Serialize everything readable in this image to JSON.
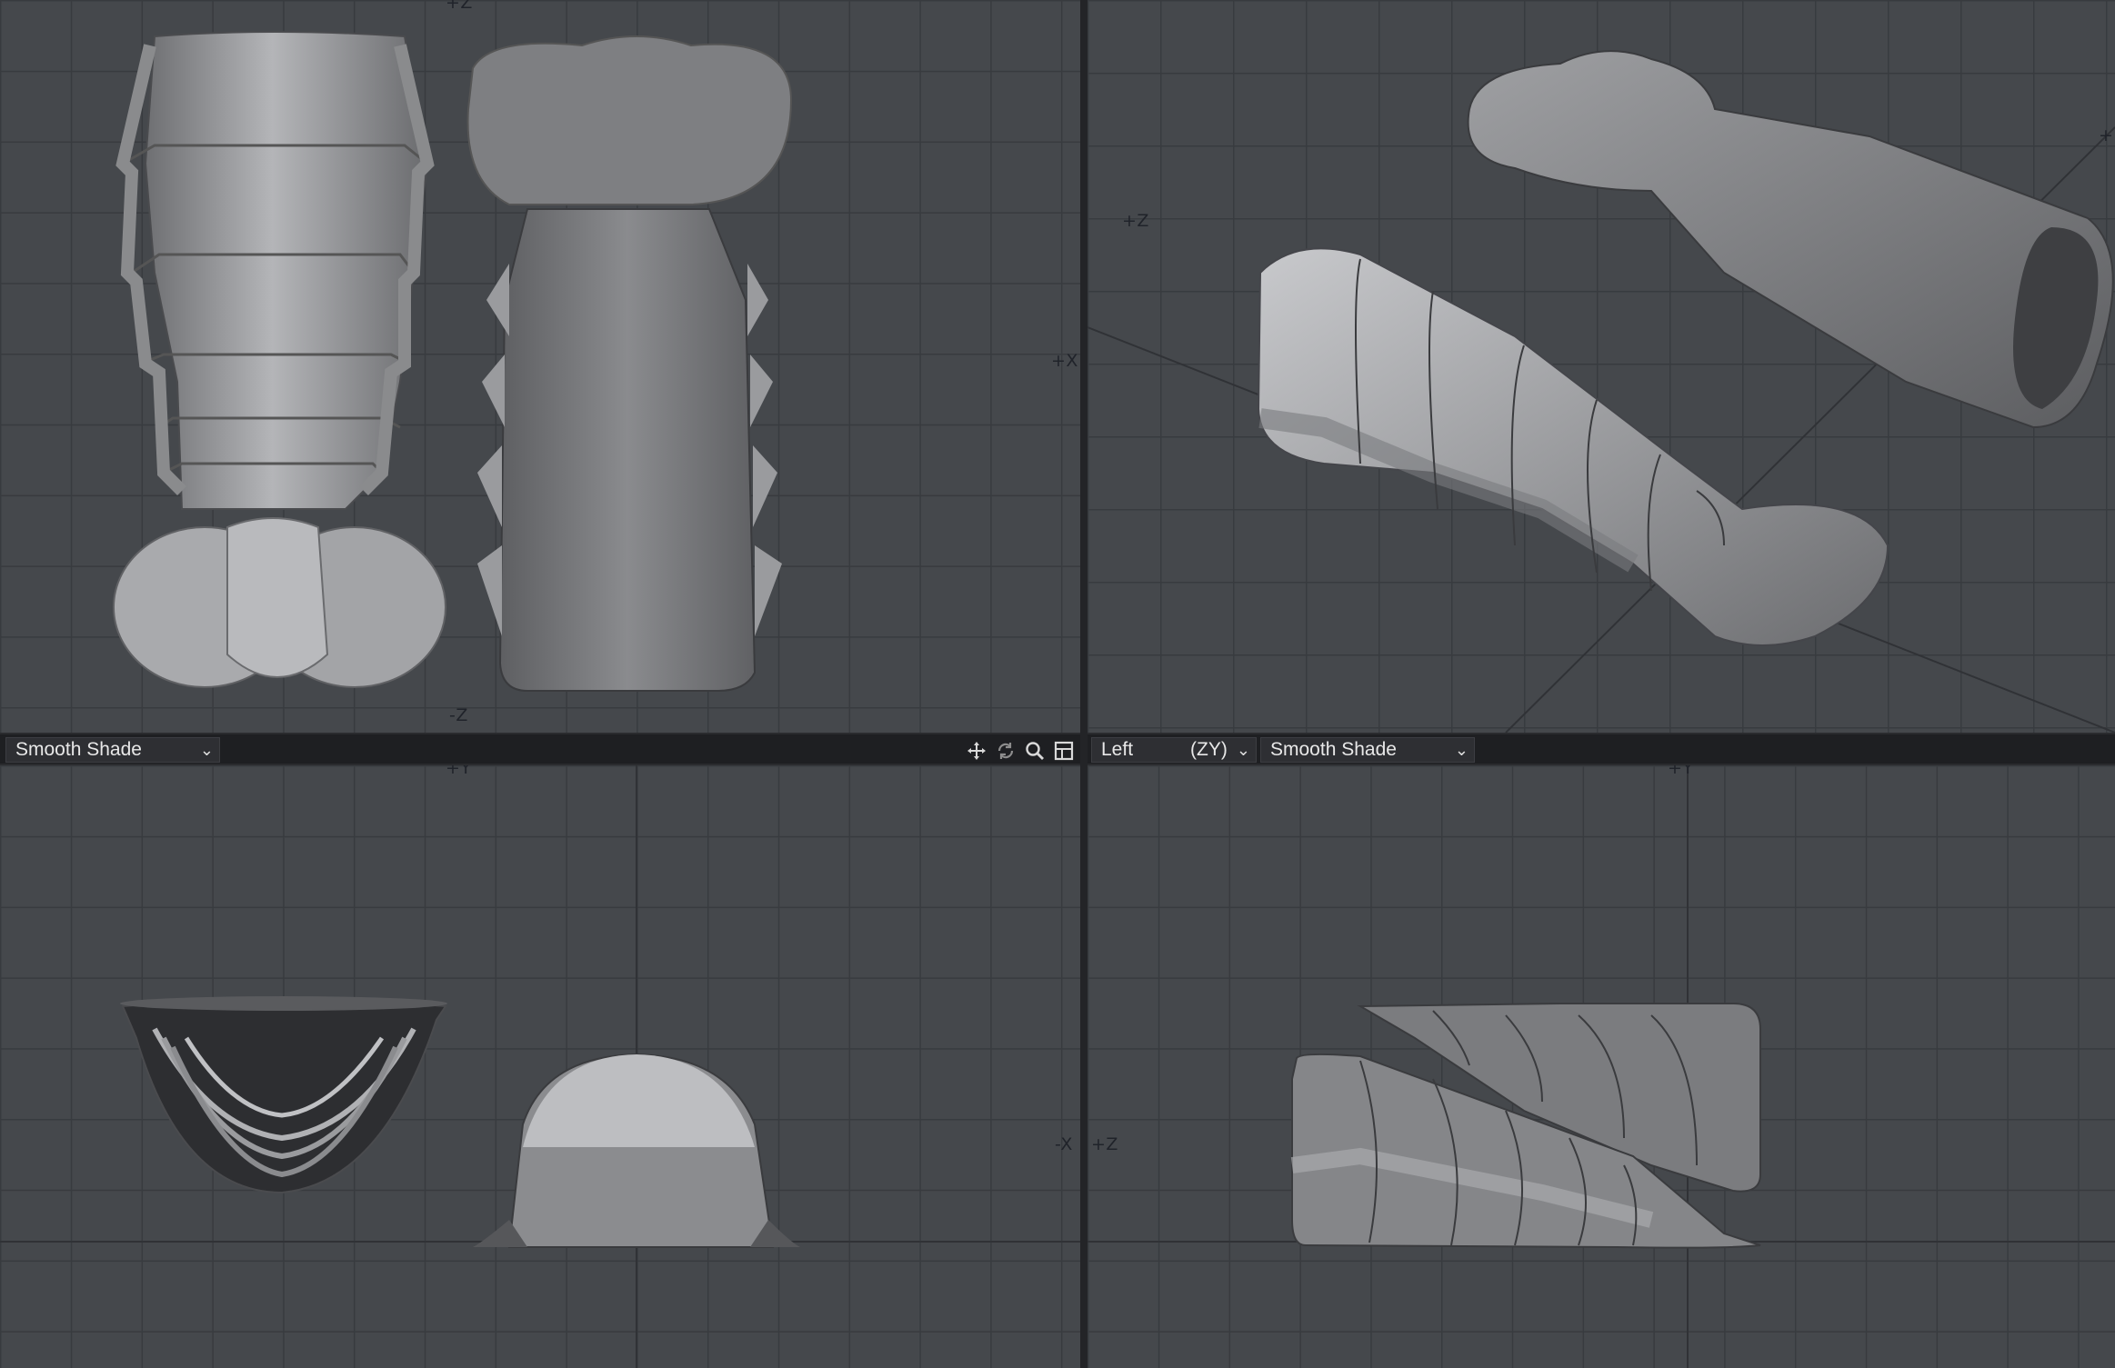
{
  "viewports": {
    "top_left": {
      "axes": {
        "top": "+Z",
        "right": "+X",
        "bottom": "-Z"
      }
    },
    "top_right": {
      "axes": {
        "left": "+Z",
        "right": "+"
      }
    },
    "bottom_left": {
      "shade_mode": "Smooth Shade",
      "axes": {
        "top": "+Y",
        "right": "-X"
      },
      "toolbar_icons": [
        "move-icon",
        "rotate-icon",
        "zoom-icon",
        "maximize-icon"
      ]
    },
    "bottom_right": {
      "view": "Left",
      "view_axes": "(ZY)",
      "shade_mode": "Smooth Shade",
      "axes": {
        "top": "+Y",
        "left": "+Z"
      }
    }
  },
  "colors": {
    "viewport_bg": "#45484c",
    "grid": "#383b3f",
    "bar_bg": "#1e1f22",
    "model": "#8c8d90"
  }
}
